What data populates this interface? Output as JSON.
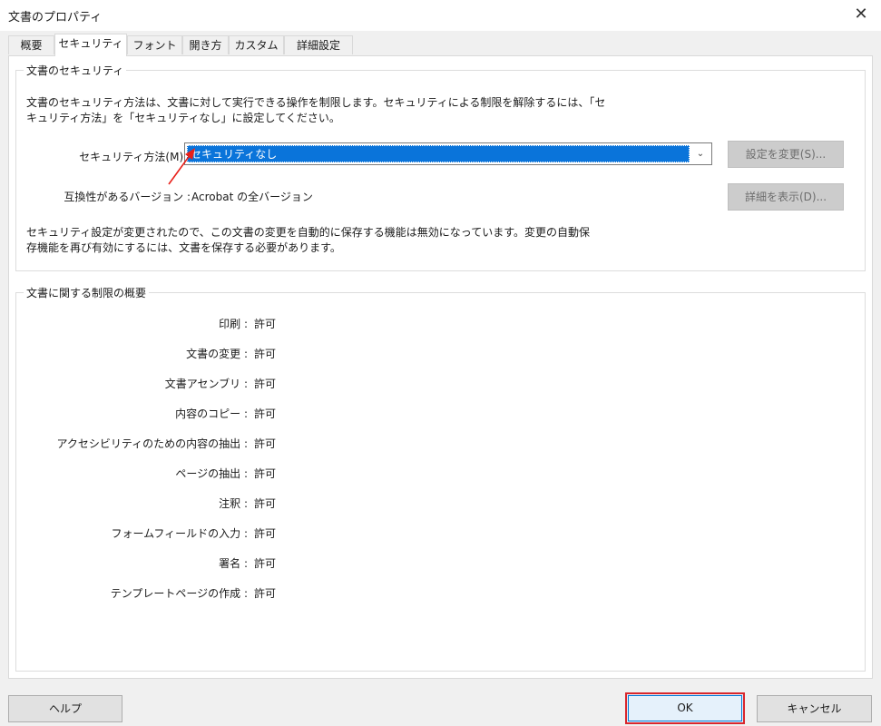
{
  "window": {
    "title": "文書のプロパティ",
    "close_glyph": "✕"
  },
  "tabs": [
    {
      "label": "概要",
      "active": false
    },
    {
      "label": "セキュリティ",
      "active": true
    },
    {
      "label": "フォント",
      "active": false
    },
    {
      "label": "開き方",
      "active": false
    },
    {
      "label": "カスタム",
      "active": false
    },
    {
      "label": "詳細設定",
      "active": false
    }
  ],
  "security_group": {
    "legend": "文書のセキュリティ",
    "description": "文書のセキュリティ方法は、文書に対して実行できる操作を制限します。セキュリティによる制限を解除するには、「セ\nキュリティ方法」を「セキュリティなし」に設定してください。",
    "method_label": "セキュリティ方法(M) :",
    "method_value": "セキュリティなし",
    "change_settings_button": "設定を変更(S)...",
    "compat_label": "互換性があるバージョン :",
    "compat_value": "Acrobat の全バージョン",
    "show_details_button": "詳細を表示(D)...",
    "note": "セキュリティ設定が変更されたので、この文書の変更を自動的に保存する機能は無効になっています。変更の自動保\n存機能を再び有効にするには、文書を保存する必要があります。"
  },
  "restrictions_group": {
    "legend": "文書に関する制限の概要",
    "items": [
      {
        "label": "印刷 :",
        "value": "許可"
      },
      {
        "label": "文書の変更 :",
        "value": "許可"
      },
      {
        "label": "文書アセンブリ :",
        "value": "許可"
      },
      {
        "label": "内容のコピー :",
        "value": "許可"
      },
      {
        "label": "アクセシビリティのための内容の抽出 :",
        "value": "許可"
      },
      {
        "label": "ページの抽出 :",
        "value": "許可"
      },
      {
        "label": "注釈 :",
        "value": "許可"
      },
      {
        "label": "フォームフィールドの入力 :",
        "value": "許可"
      },
      {
        "label": "署名 :",
        "value": "許可"
      },
      {
        "label": "テンプレートページの作成 :",
        "value": "許可"
      }
    ]
  },
  "footer": {
    "help_button": "ヘルプ",
    "ok_button": "OK",
    "cancel_button": "キャンセル"
  },
  "colors": {
    "selection": "#0a74da",
    "highlight_outline": "#d9262c",
    "annotation_arrow": "#e8201a"
  }
}
